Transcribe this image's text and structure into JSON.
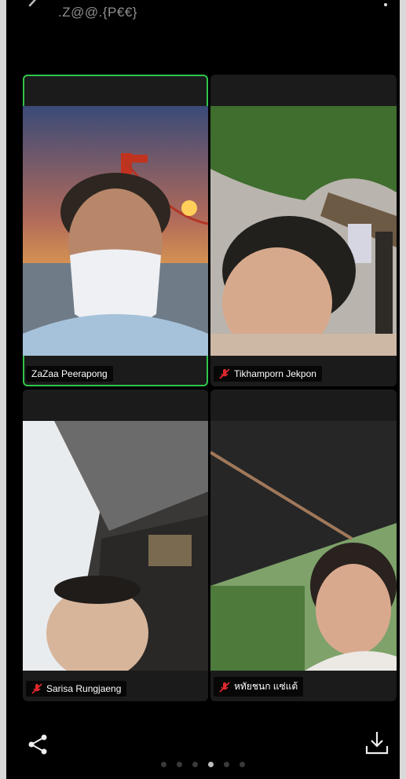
{
  "meeting": {
    "title": ".Z@@.{P€€}"
  },
  "participants": [
    {
      "name": "ZaZaa Peerapong",
      "muted": false,
      "active": true
    },
    {
      "name": "Tikhamporn Jekpon",
      "muted": true,
      "active": false
    },
    {
      "name": "Sarisa Rungjaeng",
      "muted": true,
      "active": false
    },
    {
      "name": "หทัยชนก แซ่แต้",
      "muted": true,
      "active": false
    }
  ],
  "pager": {
    "total": 6,
    "current": 4
  },
  "colors": {
    "active_border": "#2fc54a",
    "mute": "#e0282e",
    "tile_bg": "#1b1b1b"
  }
}
